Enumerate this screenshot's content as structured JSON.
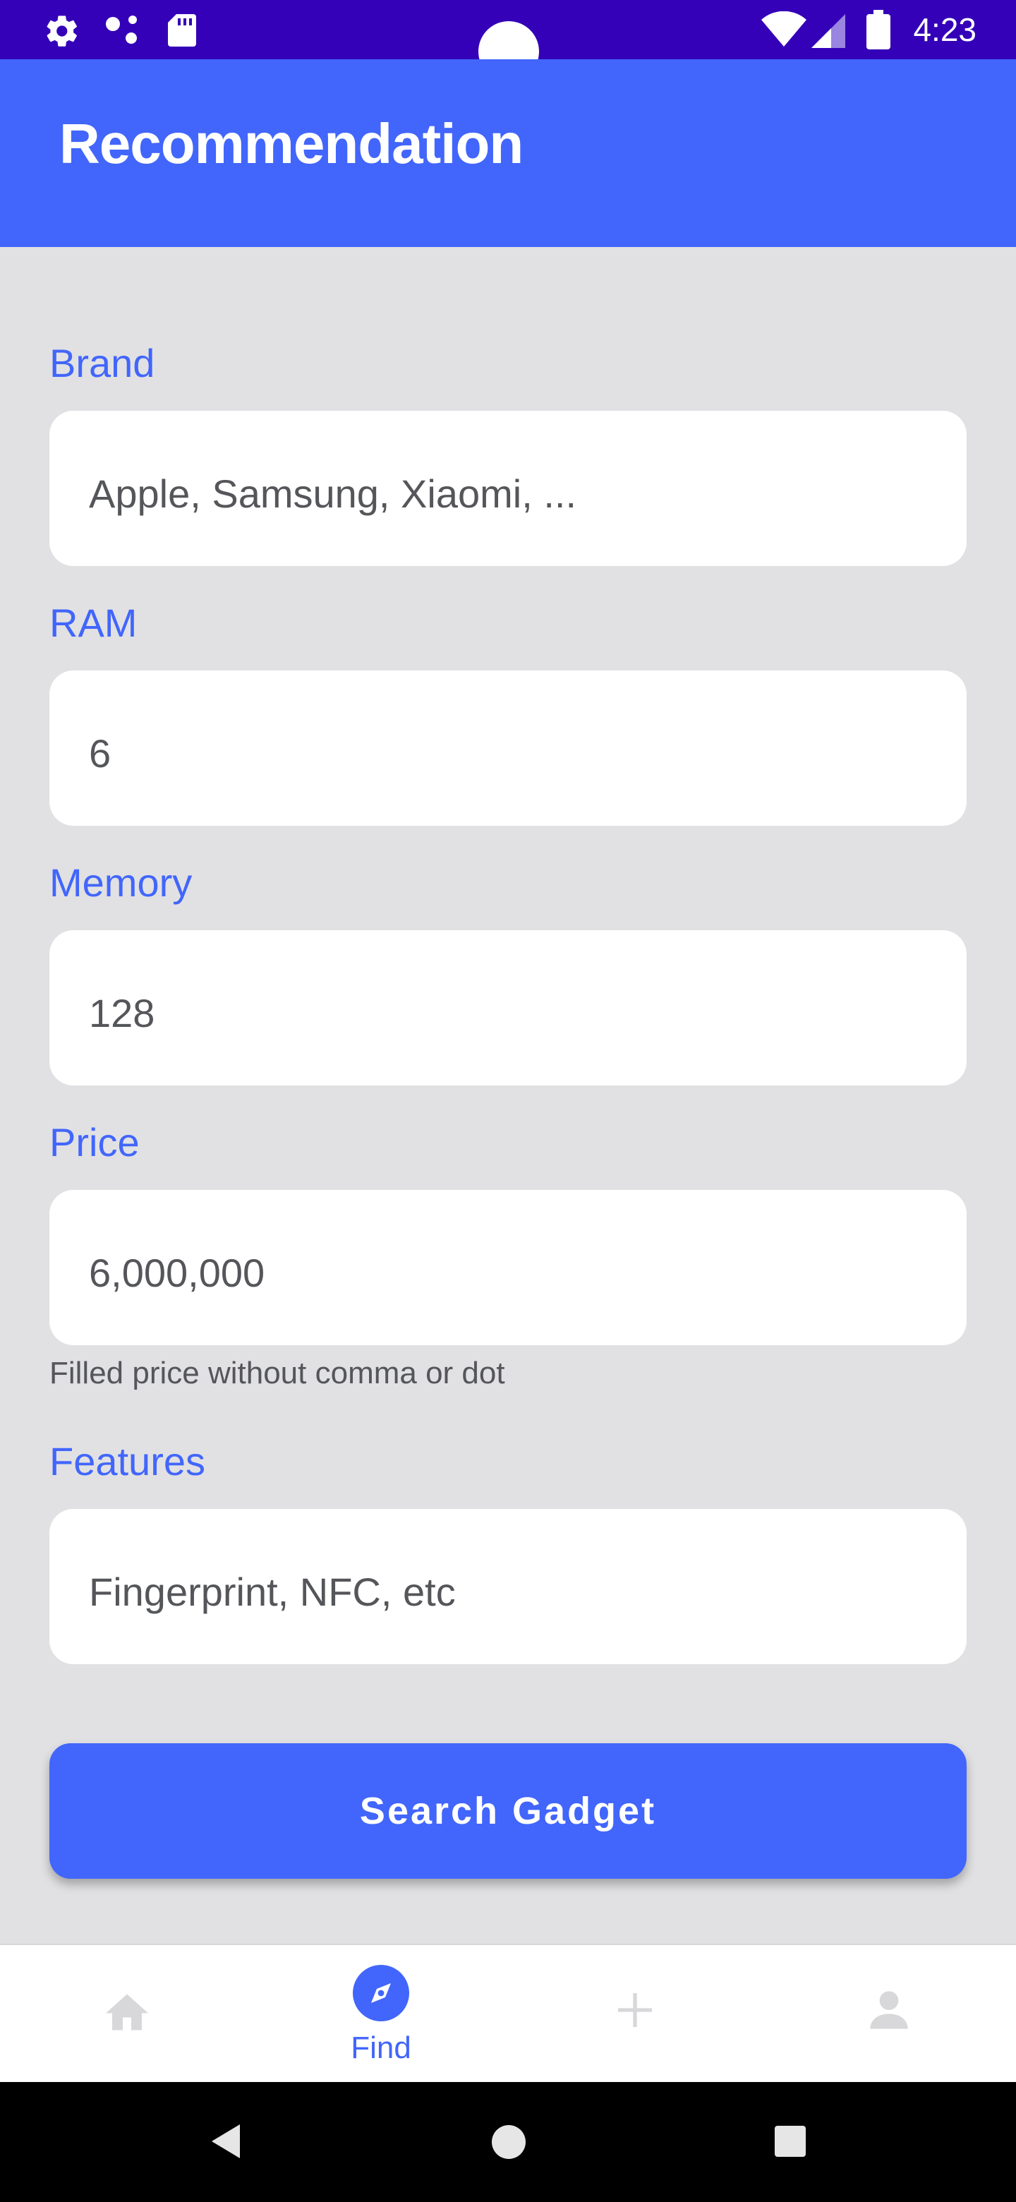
{
  "status_bar": {
    "time": "4:23",
    "left_icons": [
      "gear-icon",
      "assistant-dots-icon",
      "sd-card-icon"
    ],
    "right_icons": [
      "wifi-icon",
      "cell-signal-icon",
      "battery-icon"
    ]
  },
  "app_bar": {
    "title": "Recommendation"
  },
  "form": {
    "brand": {
      "label": "Brand",
      "placeholder": "Apple, Samsung, Xiaomi, ..."
    },
    "ram": {
      "label": "RAM",
      "value": "6"
    },
    "memory": {
      "label": "Memory",
      "value": "128"
    },
    "price": {
      "label": "Price",
      "value": "6,000,000",
      "hint": "Filled price without comma or dot"
    },
    "features": {
      "label": "Features",
      "placeholder": "Fingerprint, NFC, etc"
    },
    "submit_label": "Search Gadget"
  },
  "bottom_nav": {
    "items": [
      {
        "icon": "home-icon",
        "label": ""
      },
      {
        "icon": "compass-icon",
        "label": "Find",
        "active": true
      },
      {
        "icon": "plus-icon",
        "label": ""
      },
      {
        "icon": "profile-icon",
        "label": ""
      }
    ]
  },
  "colors": {
    "primary": "#4266fb",
    "status_bar": "#3400b8",
    "background": "#e1e1e3",
    "field_text": "#55565a",
    "inactive_nav": "#d8d8da"
  }
}
